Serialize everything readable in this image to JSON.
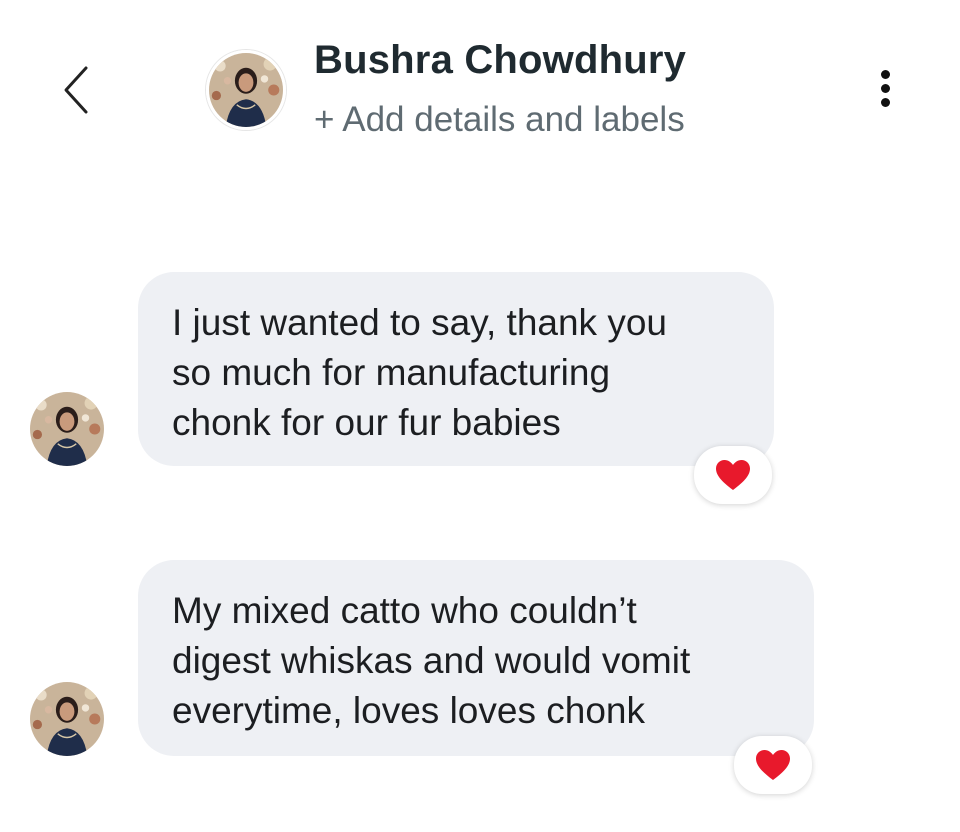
{
  "header": {
    "back_icon": "chevron-left-icon",
    "contact_name": "Bushra Chowdhury",
    "add_details_label": "+ Add details and labels",
    "menu_icon": "vertical-ellipsis-icon"
  },
  "messages": [
    {
      "lines": [
        "I just wanted to say, thank you",
        "so much for manufacturing",
        "chonk for our fur babies"
      ],
      "reaction": "heart"
    },
    {
      "lines": [
        "My mixed catto who couldn’t",
        "digest whiskas and would vomit",
        "everytime, loves loves chonk"
      ],
      "reaction": "heart"
    }
  ],
  "colors": {
    "bubble_bg": "#eef0f4",
    "heart": "#e8192c",
    "name_text": "#1f2a30",
    "subtitle_text": "#5f6b72"
  }
}
